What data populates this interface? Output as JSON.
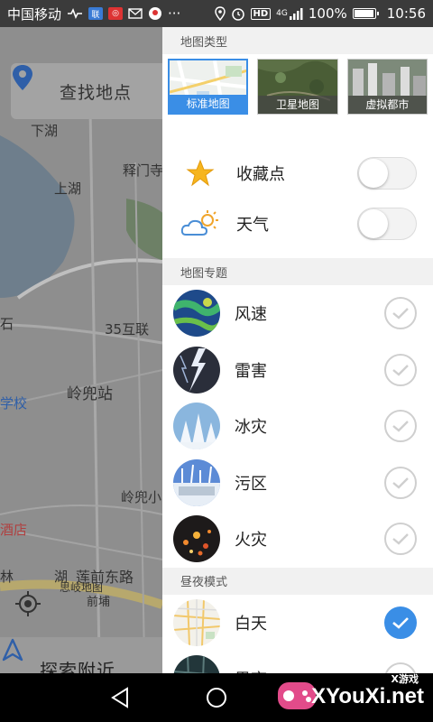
{
  "statusbar": {
    "carrier": "中国移动",
    "battery_text": "100%",
    "battery_level": 1.0,
    "time": "10:56",
    "hd_badge": "HD",
    "signal_label": "4G"
  },
  "map": {
    "search_placeholder": "查找地点",
    "nearby_label": "探索附近",
    "place_labels": [
      "下湖",
      "释门寺",
      "上湖",
      "35互联",
      "岭兜站",
      "学校",
      "岭兜小",
      "酒店",
      "莲前东路",
      "思岐地图",
      "前埔",
      "林",
      "湖",
      "石"
    ]
  },
  "panel": {
    "section_map_type": "地图类型",
    "map_types": [
      {
        "label": "标准地图",
        "selected": true
      },
      {
        "label": "卫星地图",
        "selected": false
      },
      {
        "label": "虚拟都市",
        "selected": false
      }
    ],
    "toggles": [
      {
        "label": "收藏点",
        "icon": "star-icon",
        "on": false
      },
      {
        "label": "天气",
        "icon": "weather-icon",
        "on": false
      }
    ],
    "section_topics": "地图专题",
    "topics": [
      {
        "label": "风速",
        "checked": false
      },
      {
        "label": "雷害",
        "checked": false
      },
      {
        "label": "冰灾",
        "checked": false
      },
      {
        "label": "污区",
        "checked": false
      },
      {
        "label": "火灾",
        "checked": false
      }
    ],
    "section_day_night": "昼夜模式",
    "day_night": [
      {
        "label": "白天",
        "checked": true
      },
      {
        "label": "黑夜",
        "checked": false
      }
    ]
  },
  "watermark": {
    "sub": "X游戏",
    "main": "XYouXi.net"
  },
  "colors": {
    "accent": "#3a8ee6",
    "statusbar": "#3b3b3b",
    "overlay_map": "#8b8b8b"
  }
}
